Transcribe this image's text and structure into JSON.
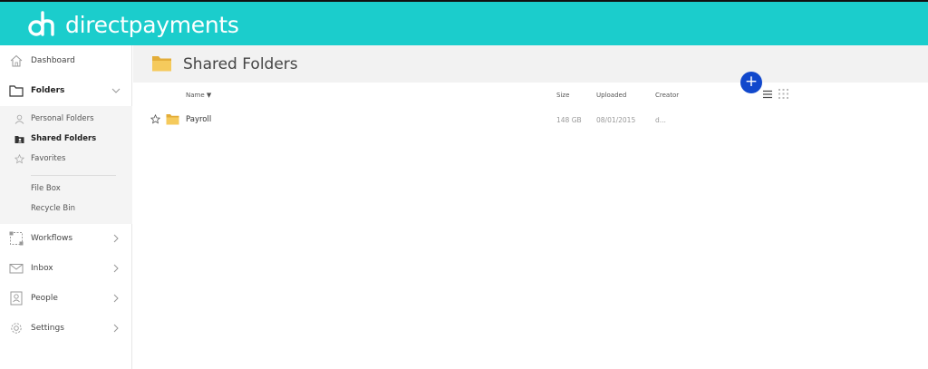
{
  "brand": {
    "name": "directpayments",
    "colors": {
      "topbar": "#1bcdcc",
      "fab": "#1148cc",
      "folder": "#f2c24f"
    }
  },
  "sidebar": {
    "items": [
      {
        "label": "Dashboard",
        "icon": "home-icon"
      },
      {
        "label": "Folders",
        "icon": "folder-icon",
        "expanded": true
      },
      {
        "label": "Workflows",
        "icon": "workflow-icon"
      },
      {
        "label": "Inbox",
        "icon": "mail-icon"
      },
      {
        "label": "People",
        "icon": "person-card-icon"
      },
      {
        "label": "Settings",
        "icon": "gear-icon"
      }
    ],
    "folders_sub": [
      {
        "label": "Personal Folders",
        "icon": "person-icon"
      },
      {
        "label": "Shared Folders",
        "icon": "shared-folder-icon",
        "active": true
      },
      {
        "label": "Favorites",
        "icon": "star-icon"
      },
      {
        "label": "File Box"
      },
      {
        "label": "Recycle Bin"
      }
    ]
  },
  "main": {
    "title": "Shared Folders",
    "fab_label": "+",
    "columns": {
      "name": "Name ▼",
      "size": "Size",
      "uploaded": "Uploaded",
      "creator": "Creator"
    },
    "rows": [
      {
        "name": "Payroll",
        "size": "148 GB",
        "uploaded": "08/01/2015",
        "creator": "d..."
      }
    ]
  }
}
